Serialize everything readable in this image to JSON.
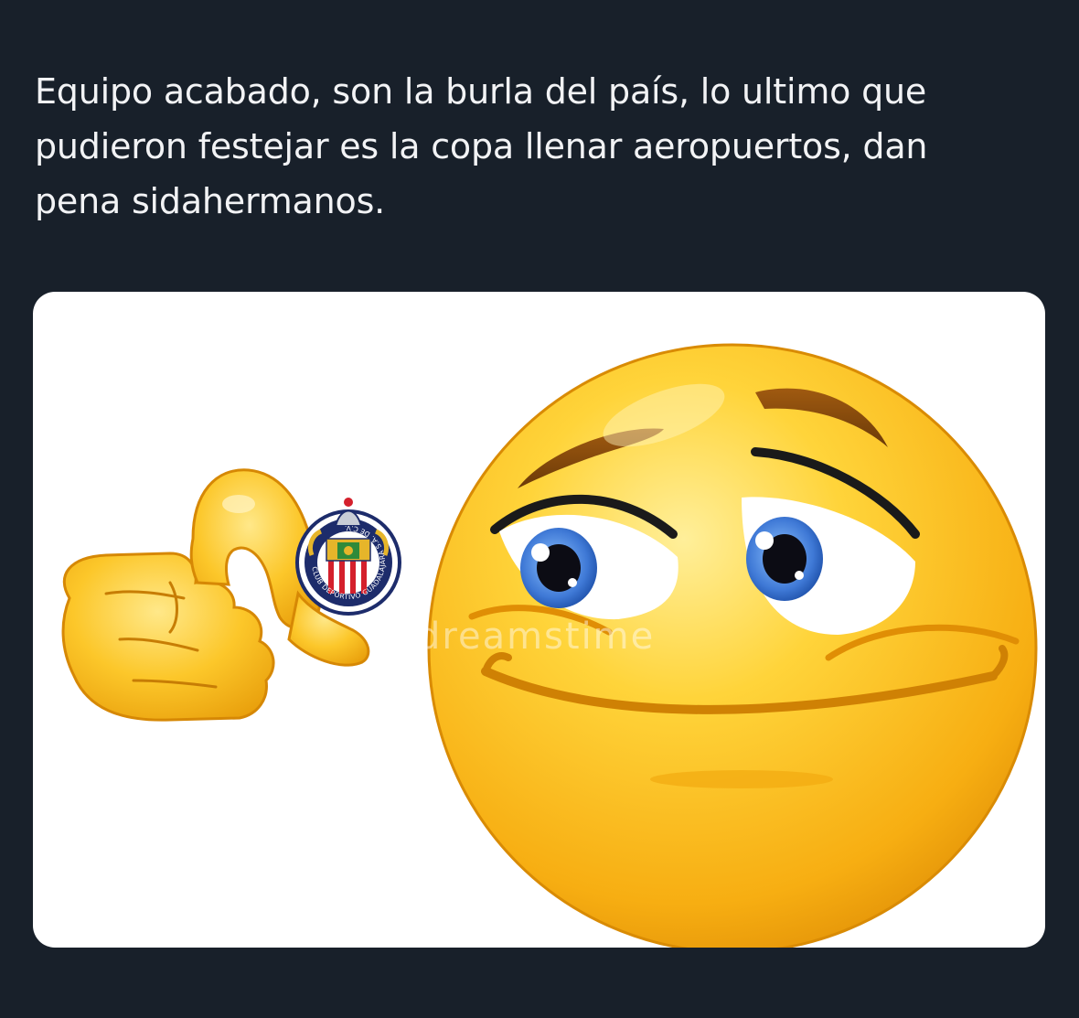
{
  "post": {
    "text": "Equipo acabado, son la burla del país, lo ultimo que\npudieron festejar es la copa llenar aeropuertos, dan\npena sidahermanos."
  },
  "media": {
    "watermark": "dreamstime",
    "badge_ring_text": "CLUB DEPORTIVO GUADALAJARA S.A. DE C.V.",
    "colors": {
      "background": "#18202a",
      "text": "#f2f3f5",
      "card": "#ffffff",
      "emoji_yellow": "#fbbf1a",
      "emoji_light": "#ffe680",
      "emoji_dark": "#e39a05",
      "badge_navy": "#1d2c6b",
      "badge_red": "#d4202c",
      "iris_blue": "#3f79d6"
    }
  }
}
